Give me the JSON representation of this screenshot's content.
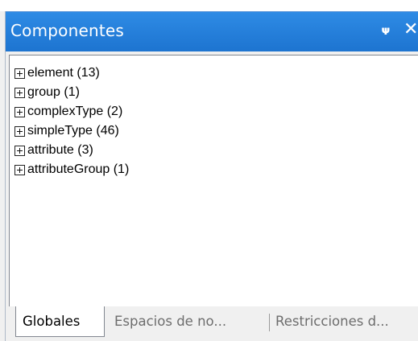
{
  "panel": {
    "title": "Componentes",
    "pin_glyph": "Ὄc",
    "close_glyph": "×"
  },
  "tree": {
    "items": [
      {
        "label": "element (13)"
      },
      {
        "label": "group (1)"
      },
      {
        "label": "complexType (2)"
      },
      {
        "label": "simpleType (46)"
      },
      {
        "label": "attribute (3)"
      },
      {
        "label": "attributeGroup (1)"
      }
    ],
    "expander_icon": "plus-box-icon"
  },
  "tabs": {
    "items": [
      {
        "label": "Globales",
        "active": true
      },
      {
        "label": "Espacios de no...",
        "active": false
      },
      {
        "label": "Restricciones d...",
        "active": false
      }
    ]
  },
  "colors": {
    "titlebar": "#1d74d0",
    "tree_background": "#ffffff",
    "panel_background": "#f0f0f0"
  }
}
